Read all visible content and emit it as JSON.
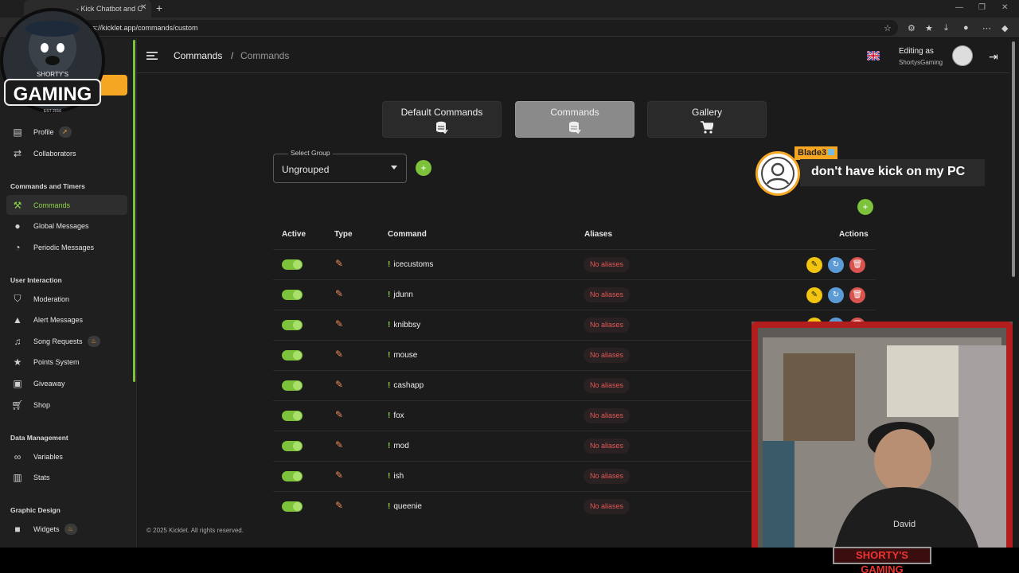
{
  "browser": {
    "tab_title": "- Kick Chatbot and C",
    "url": "s://kicklet.app/commands/custom"
  },
  "sidebar": {
    "items_top": [
      {
        "label": "Profile",
        "icon": "clipboard-icon",
        "badge": "rocket"
      },
      {
        "label": "Collaborators",
        "icon": "handshake-icon"
      }
    ],
    "section_commands": "Commands and Timers",
    "commands_items": [
      {
        "label": "Commands",
        "icon": "hammer-icon",
        "active": true
      },
      {
        "label": "Global Messages",
        "icon": "speech-bubble-icon"
      },
      {
        "label": "Periodic Messages",
        "icon": "clock-icon"
      }
    ],
    "section_user": "User Interaction",
    "user_items": [
      {
        "label": "Moderation",
        "icon": "shield-icon"
      },
      {
        "label": "Alert Messages",
        "icon": "warning-icon"
      },
      {
        "label": "Song Requests",
        "icon": "music-icon",
        "badge": "fire"
      },
      {
        "label": "Points System",
        "icon": "star-icon"
      },
      {
        "label": "Giveaway",
        "icon": "gift-icon"
      },
      {
        "label": "Shop",
        "icon": "cart-icon"
      }
    ],
    "section_data": "Data Management",
    "data_items": [
      {
        "label": "Variables",
        "icon": "link-icon"
      },
      {
        "label": "Stats",
        "icon": "bar-chart-icon"
      }
    ],
    "section_graphic": "Graphic Design",
    "graphic_items": [
      {
        "label": "Widgets",
        "icon": "video-icon",
        "badge": "fire"
      }
    ]
  },
  "logo": {
    "line1": "SHORTY'S",
    "line2": "GAMING",
    "line3": "EST 2016"
  },
  "header": {
    "crumb1": "Commands",
    "separator": "/",
    "crumb2": "Commands",
    "editing_as": "Editing as",
    "username": "ShortysGaming"
  },
  "tabs": {
    "default": "Default Commands",
    "commands": "Commands",
    "gallery": "Gallery"
  },
  "group": {
    "label": "Select Group",
    "value": "Ungrouped"
  },
  "table": {
    "headers": {
      "active": "Active",
      "type": "Type",
      "command": "Command",
      "aliases": "Aliases",
      "actions": "Actions"
    },
    "prefix": "!",
    "rows": [
      {
        "command": "icecustoms",
        "aliases": "No aliases"
      },
      {
        "command": "jdunn",
        "aliases": "No aliases"
      },
      {
        "command": "knibbsy",
        "aliases": "No aliases"
      },
      {
        "command": "mouse",
        "aliases": "No aliases"
      },
      {
        "command": "cashapp",
        "aliases": "No aliases"
      },
      {
        "command": "fox",
        "aliases": "No aliases"
      },
      {
        "command": "mod",
        "aliases": "No aliases"
      },
      {
        "command": "ish",
        "aliases": "No aliases"
      },
      {
        "command": "queenie",
        "aliases": "No aliases"
      }
    ]
  },
  "footer": "© 2025 Kicklet. All rights reserved.",
  "chat_overlay": {
    "username": "Blade3",
    "message": "don't have kick on my PC"
  },
  "webcam": {
    "frame_label": "SHORTY'S GAMING",
    "shirt_text": "David"
  },
  "colors": {
    "accent_green": "#7cc23a",
    "accent_orange": "#f5a623",
    "alias_red": "#e05757",
    "edit_yellow": "#f1c40f",
    "copy_blue": "#5b9bd5",
    "delete_red": "#d9534f"
  }
}
